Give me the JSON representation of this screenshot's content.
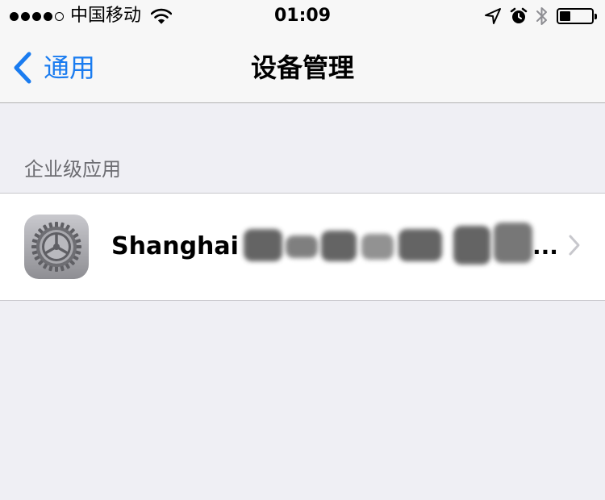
{
  "status_bar": {
    "carrier": "中国移动",
    "time": "01:09",
    "signal_bars_filled": 4,
    "battery_level": 0.35
  },
  "nav": {
    "back_label": "通用",
    "title": "设备管理"
  },
  "section": {
    "header": "企业级应用",
    "items": [
      {
        "label": "Shanghai",
        "truncation": "...",
        "icon": "settings-gear-icon"
      }
    ]
  },
  "colors": {
    "accent": "#1a7cf0",
    "background": "#efeff4",
    "bar": "#f7f7f7",
    "section_header_text": "#6d6d72"
  }
}
